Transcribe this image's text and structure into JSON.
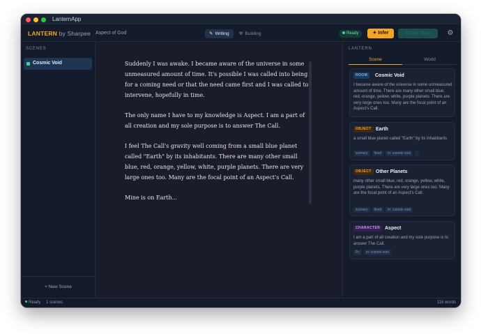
{
  "app_title": "LanternApp",
  "toolbar": {
    "brand": "LANTERN",
    "brand_by": "by Sharpee",
    "doc_name": "Aspect of God",
    "modes": [
      {
        "label": "Writing",
        "icon": "pencil-icon",
        "active": true
      },
      {
        "label": "Building",
        "icon": "hammer-icon",
        "active": false
      }
    ],
    "status_pill": "Ready",
    "infer_label": "Infer",
    "ghost_label": "Export Story"
  },
  "sidebar": {
    "heading": "SCENES",
    "scenes": [
      {
        "label": "Cosmic Void",
        "active": true
      }
    ],
    "new_scene_label": "+ New Scene"
  },
  "editor": {
    "paragraphs": [
      "Suddenly I was awake. I became aware of the universe in some unmeasured amount of time. It's possible I was called into being for a coming need or that the need came first and I was called to intervene, hopefully in time.",
      "The only name I have to my knowledge is Aspect. I am a part of all creation and my sole purpose is to answer The Call.",
      "I feel The Call's gravity well coming from a small blue planet called \"Earth\" by its inhabitants. There are many other small blue, red, orange, yellow, white, purple planets. There are very large ones too. Many are the focal point of an Aspect's Call.",
      "Mine is on Earth..."
    ]
  },
  "right_panel": {
    "heading": "LANTERN",
    "tabs": [
      {
        "label": "Scene",
        "active": true
      },
      {
        "label": "World",
        "active": false
      }
    ],
    "cards": [
      {
        "type": "ROOM",
        "title": "Cosmic Void",
        "description": "I became aware of the universe in some unmeasured amount of time. There are many other small blue, red, orange, yellow, white, purple planets. There are very large ones too. Many are the focal point of an Aspect's Call.",
        "tags": []
      },
      {
        "type": "OBJECT",
        "title": "Earth",
        "description": "a small blue planet called \"Earth\" by its inhabitants",
        "tags": [
          "scenery",
          "fixed",
          "in: cosmic-void",
          ""
        ]
      },
      {
        "type": "OBJECT",
        "title": "Other Planets",
        "description": "many other small blue, red, orange, yellow, white, purple planets. There are very large ones too. Many are the focal point of an Aspect's Call.",
        "tags": [
          "scenery",
          "fixed",
          "in: cosmic-void"
        ]
      },
      {
        "type": "CHARACTER",
        "title": "Aspect",
        "description": "I am a part of all creation and my sole purpose is to answer The Call.",
        "tags": [
          "Pc",
          "in: cosmic-void"
        ]
      }
    ]
  },
  "statusbar": {
    "ready": "Ready",
    "scenes": "1 scenes",
    "words": "116 words"
  },
  "colors": {
    "accent": "#f5a524",
    "success": "#3ed29a",
    "background": "#161c2c",
    "editor_bg": "#1a1c2a"
  }
}
